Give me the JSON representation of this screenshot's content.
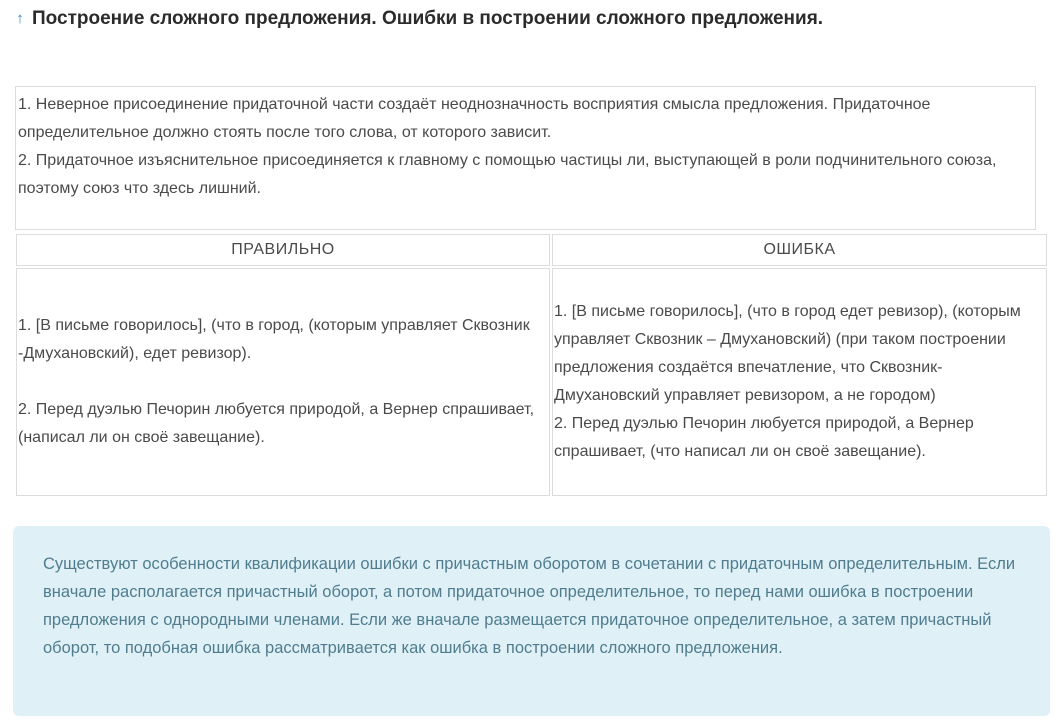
{
  "heading": {
    "icon": "arrow-up-icon",
    "title": "Построение сложного предложения. Ошибки в построении сложного предложения."
  },
  "intro": {
    "line1": "1. Неверное присоединение придаточной части создаёт неоднозначность восприятия смысла предложения. Придаточное определительное должно стоять после того слова, от которого зависит.",
    "line2": "2. Придаточное изъяснительное присоединяется к главному с помощью частицы ли, выступающей в роли подчинительного союза, поэтому союз что здесь лишний."
  },
  "table": {
    "headers": [
      "ПРАВИЛЬНО",
      "ОШИБКА"
    ],
    "correct": {
      "item1": "1. [В письме говорилось], (что в город, (которым управляет Сквозник -Дмухановский), едет ревизор).",
      "item2": "2. Перед дуэлью Печорин любуется природой, а Вернер спрашивает, (написал ли он своё завещание)."
    },
    "error": {
      "item1": "1. [В письме говорилось], (что в город едет ревизор), (которым управляет Сквозник – Дмухановский) (при таком построении предложения создаётся впечатление, что Сквозник-Дмухановский управляет ревизором, а не городом)",
      "item2": "2. Перед дуэлью Печорин любуется природой, а Вернер спрашивает, (что написал ли он своё завещание)."
    }
  },
  "note": {
    "text": "Существуют особенности квалификации ошибки с причастным оборотом в сочетании с придаточным определительным. Если вначале располагается причастный оборот, а потом придаточное определительное, то перед нами ошибка в построении предложения с однородными членами. Если же вначале размещается придаточное определительное, а затем причастный оборот, то подобная ошибка рассматривается как ошибка в построении сложного предложения."
  },
  "colors": {
    "accent": "#2f7fc1",
    "note_bg": "#dff0f6",
    "note_text": "#4f7d8f",
    "border": "#dcdcdc"
  }
}
